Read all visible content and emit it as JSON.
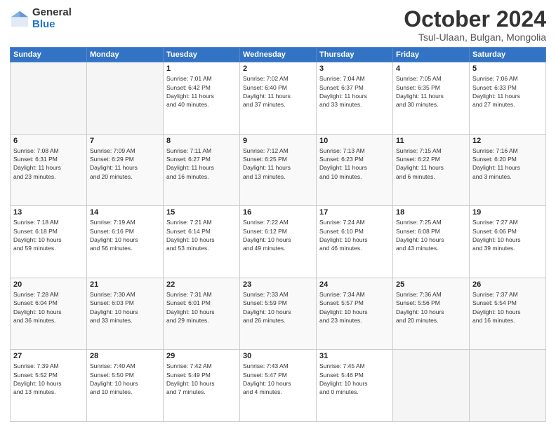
{
  "header": {
    "logo_general": "General",
    "logo_blue": "Blue",
    "month_title": "October 2024",
    "location": "Tsul-Ulaan, Bulgan, Mongolia"
  },
  "weekdays": [
    "Sunday",
    "Monday",
    "Tuesday",
    "Wednesday",
    "Thursday",
    "Friday",
    "Saturday"
  ],
  "weeks": [
    [
      {
        "day": "",
        "info": ""
      },
      {
        "day": "",
        "info": ""
      },
      {
        "day": "1",
        "info": "Sunrise: 7:01 AM\nSunset: 6:42 PM\nDaylight: 11 hours\nand 40 minutes."
      },
      {
        "day": "2",
        "info": "Sunrise: 7:02 AM\nSunset: 6:40 PM\nDaylight: 11 hours\nand 37 minutes."
      },
      {
        "day": "3",
        "info": "Sunrise: 7:04 AM\nSunset: 6:37 PM\nDaylight: 11 hours\nand 33 minutes."
      },
      {
        "day": "4",
        "info": "Sunrise: 7:05 AM\nSunset: 6:35 PM\nDaylight: 11 hours\nand 30 minutes."
      },
      {
        "day": "5",
        "info": "Sunrise: 7:06 AM\nSunset: 6:33 PM\nDaylight: 11 hours\nand 27 minutes."
      }
    ],
    [
      {
        "day": "6",
        "info": "Sunrise: 7:08 AM\nSunset: 6:31 PM\nDaylight: 11 hours\nand 23 minutes."
      },
      {
        "day": "7",
        "info": "Sunrise: 7:09 AM\nSunset: 6:29 PM\nDaylight: 11 hours\nand 20 minutes."
      },
      {
        "day": "8",
        "info": "Sunrise: 7:11 AM\nSunset: 6:27 PM\nDaylight: 11 hours\nand 16 minutes."
      },
      {
        "day": "9",
        "info": "Sunrise: 7:12 AM\nSunset: 6:25 PM\nDaylight: 11 hours\nand 13 minutes."
      },
      {
        "day": "10",
        "info": "Sunrise: 7:13 AM\nSunset: 6:23 PM\nDaylight: 11 hours\nand 10 minutes."
      },
      {
        "day": "11",
        "info": "Sunrise: 7:15 AM\nSunset: 6:22 PM\nDaylight: 11 hours\nand 6 minutes."
      },
      {
        "day": "12",
        "info": "Sunrise: 7:16 AM\nSunset: 6:20 PM\nDaylight: 11 hours\nand 3 minutes."
      }
    ],
    [
      {
        "day": "13",
        "info": "Sunrise: 7:18 AM\nSunset: 6:18 PM\nDaylight: 10 hours\nand 59 minutes."
      },
      {
        "day": "14",
        "info": "Sunrise: 7:19 AM\nSunset: 6:16 PM\nDaylight: 10 hours\nand 56 minutes."
      },
      {
        "day": "15",
        "info": "Sunrise: 7:21 AM\nSunset: 6:14 PM\nDaylight: 10 hours\nand 53 minutes."
      },
      {
        "day": "16",
        "info": "Sunrise: 7:22 AM\nSunset: 6:12 PM\nDaylight: 10 hours\nand 49 minutes."
      },
      {
        "day": "17",
        "info": "Sunrise: 7:24 AM\nSunset: 6:10 PM\nDaylight: 10 hours\nand 46 minutes."
      },
      {
        "day": "18",
        "info": "Sunrise: 7:25 AM\nSunset: 6:08 PM\nDaylight: 10 hours\nand 43 minutes."
      },
      {
        "day": "19",
        "info": "Sunrise: 7:27 AM\nSunset: 6:06 PM\nDaylight: 10 hours\nand 39 minutes."
      }
    ],
    [
      {
        "day": "20",
        "info": "Sunrise: 7:28 AM\nSunset: 6:04 PM\nDaylight: 10 hours\nand 36 minutes."
      },
      {
        "day": "21",
        "info": "Sunrise: 7:30 AM\nSunset: 6:03 PM\nDaylight: 10 hours\nand 33 minutes."
      },
      {
        "day": "22",
        "info": "Sunrise: 7:31 AM\nSunset: 6:01 PM\nDaylight: 10 hours\nand 29 minutes."
      },
      {
        "day": "23",
        "info": "Sunrise: 7:33 AM\nSunset: 5:59 PM\nDaylight: 10 hours\nand 26 minutes."
      },
      {
        "day": "24",
        "info": "Sunrise: 7:34 AM\nSunset: 5:57 PM\nDaylight: 10 hours\nand 23 minutes."
      },
      {
        "day": "25",
        "info": "Sunrise: 7:36 AM\nSunset: 5:56 PM\nDaylight: 10 hours\nand 20 minutes."
      },
      {
        "day": "26",
        "info": "Sunrise: 7:37 AM\nSunset: 5:54 PM\nDaylight: 10 hours\nand 16 minutes."
      }
    ],
    [
      {
        "day": "27",
        "info": "Sunrise: 7:39 AM\nSunset: 5:52 PM\nDaylight: 10 hours\nand 13 minutes."
      },
      {
        "day": "28",
        "info": "Sunrise: 7:40 AM\nSunset: 5:50 PM\nDaylight: 10 hours\nand 10 minutes."
      },
      {
        "day": "29",
        "info": "Sunrise: 7:42 AM\nSunset: 5:49 PM\nDaylight: 10 hours\nand 7 minutes."
      },
      {
        "day": "30",
        "info": "Sunrise: 7:43 AM\nSunset: 5:47 PM\nDaylight: 10 hours\nand 4 minutes."
      },
      {
        "day": "31",
        "info": "Sunrise: 7:45 AM\nSunset: 5:46 PM\nDaylight: 10 hours\nand 0 minutes."
      },
      {
        "day": "",
        "info": ""
      },
      {
        "day": "",
        "info": ""
      }
    ]
  ]
}
